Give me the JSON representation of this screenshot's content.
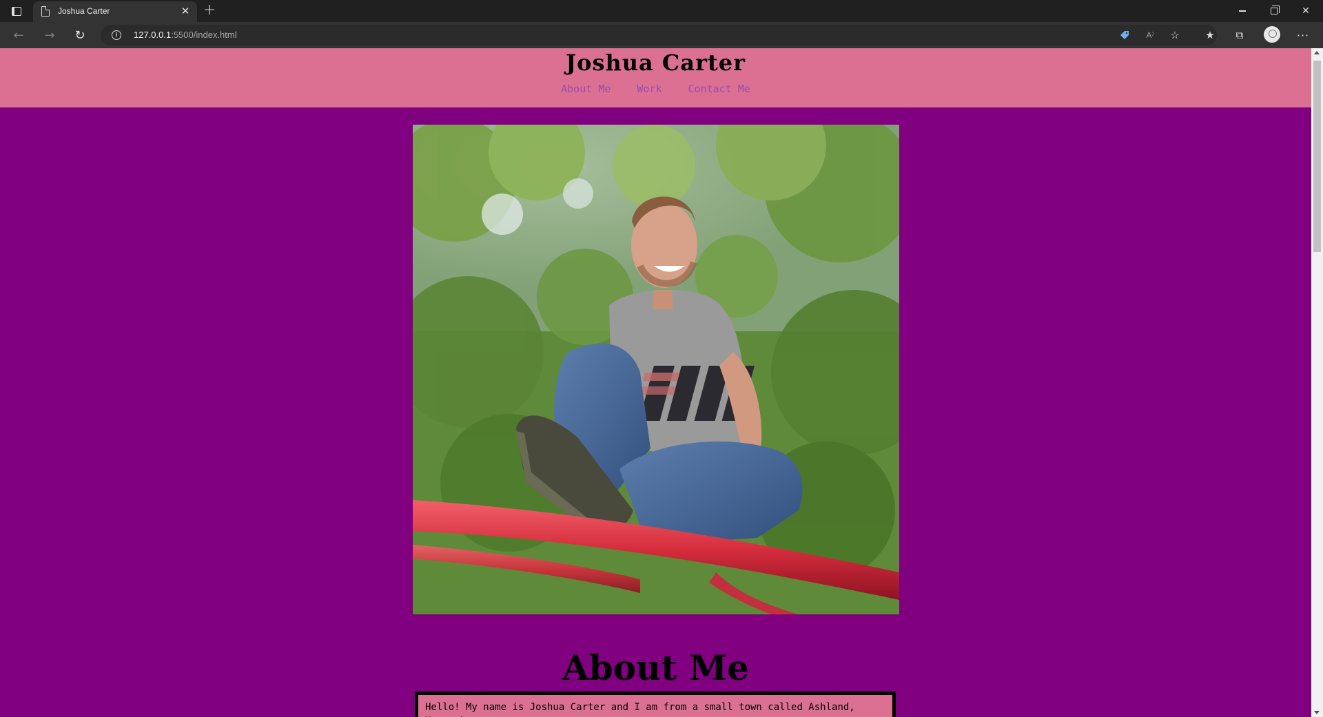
{
  "browser": {
    "tab_title": "Joshua Carter",
    "url_host": "127.0.0.1",
    "url_rest": ":5500/index.html",
    "icons": [
      "tab-actions-icon",
      "page-icon",
      "close-icon",
      "plus-icon",
      "back-arrow-icon",
      "forward-arrow-icon",
      "reload-icon",
      "info-icon",
      "tag-icon",
      "read-aloud-icon",
      "add-favorite-icon",
      "favorites-icon",
      "collections-icon",
      "profile-icon",
      "more-icon"
    ],
    "read_aloud_label": "A⁾",
    "tab_close_glyph": "✕",
    "new_tab_glyph": "+",
    "back_glyph": "←",
    "forward_glyph": "→",
    "reload_glyph": "↻",
    "info_glyph": "i",
    "add_favorite_glyph": "☆",
    "favorites_glyph": "★",
    "collections_glyph": "⧉",
    "more_glyph": "···",
    "close_window_glyph": "✕"
  },
  "site": {
    "title": "Joshua Carter",
    "nav": [
      "About Me",
      "Work",
      "Contact Me"
    ]
  },
  "about": {
    "heading": "About Me",
    "text": "Hello! My name is Joshua Carter and I am from a small town called Ashland, Massachusetts."
  },
  "colors": {
    "page_background": "#800080",
    "header_background": "#db7093",
    "nav_link": "#9b4bb0"
  }
}
